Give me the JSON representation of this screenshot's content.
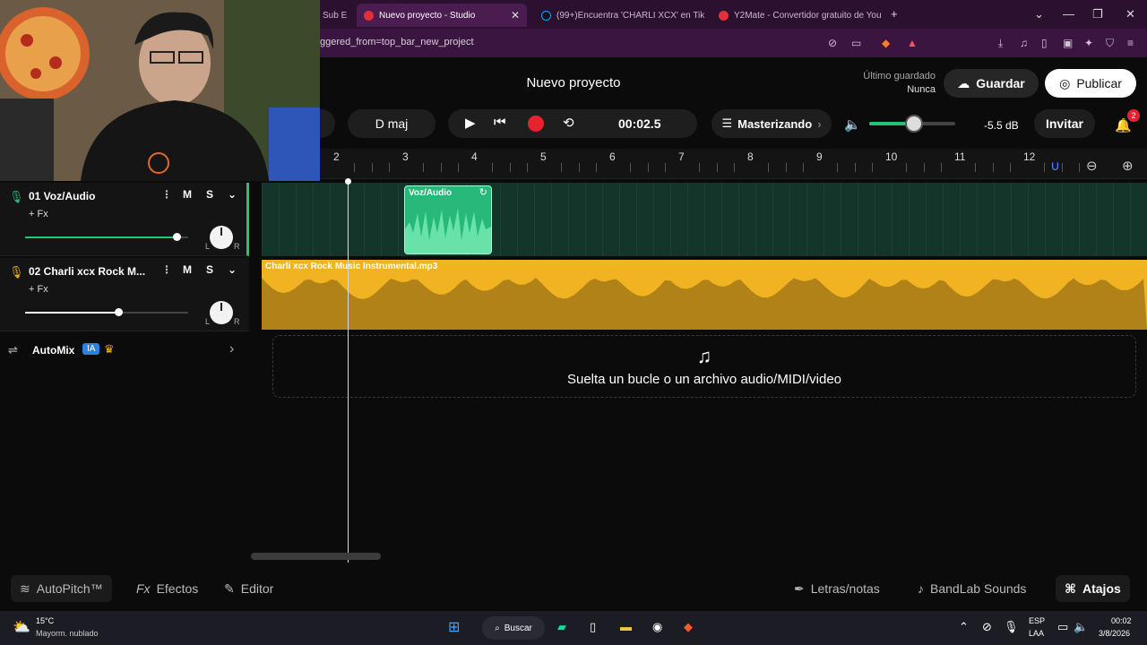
{
  "browser": {
    "tabs": [
      {
        "label": "Sub E",
        "active": false
      },
      {
        "label": "Nuevo proyecto - Studio",
        "active": true
      },
      {
        "label": "(99+)Encuentra 'CHARLI XCX' en Tik",
        "active": false
      },
      {
        "label": "Y2Mate - Convertidor gratuito de You",
        "active": false
      }
    ],
    "url": "ggered_from=top_bar_new_project"
  },
  "header": {
    "title": "Nuevo proyecto",
    "last_saved_label": "Último guardado",
    "last_saved_value": "Nunca",
    "save_label": "Guardar",
    "publish_label": "Publicar"
  },
  "transport": {
    "key": "D maj",
    "time": "00:02.5",
    "mastering_label": "Masterizando",
    "volume_db": "-5.5 dB",
    "volume_level": 0.52,
    "invite_label": "Invitar",
    "notifications": "2"
  },
  "ruler": {
    "bars": [
      "2",
      "3",
      "4",
      "5",
      "6",
      "7",
      "8",
      "9",
      "10",
      "11",
      "12"
    ]
  },
  "tracks": [
    {
      "name": "01  Voz/Audio",
      "fx": "+ Fx",
      "mute": "M",
      "solo": "S",
      "volume": 0.93,
      "color": "#22c47a",
      "pan_left": "L",
      "pan_right": "R"
    },
    {
      "name": "02  Charli xcx  Rock M...",
      "fx": "+ Fx",
      "mute": "M",
      "solo": "S",
      "volume": 0.57,
      "color": "#f1b321",
      "pan_left": "L",
      "pan_right": "R"
    }
  ],
  "automix": {
    "label": "AutoMix",
    "badge": "IA"
  },
  "clips": {
    "voice": "Voz/Audio",
    "music": "Charli xcx  Rock Music  Instrumental.mp3"
  },
  "dropzone": "Suelta un bucle o un archivo audio/MIDI/video",
  "bottombar": {
    "autopitch": "AutoPitch™",
    "effects": "Efectos",
    "editor": "Editor",
    "lyrics": "Letras/notas",
    "sounds": "BandLab Sounds",
    "shortcuts": "Atajos"
  },
  "taskbar": {
    "weather_temp": "15°C",
    "weather_desc": "Mayorm. nublado",
    "search": "Buscar",
    "lang1": "ESP",
    "lang2": "LAA",
    "clock_time": "00:02",
    "clock_date": "3/8/2026"
  }
}
